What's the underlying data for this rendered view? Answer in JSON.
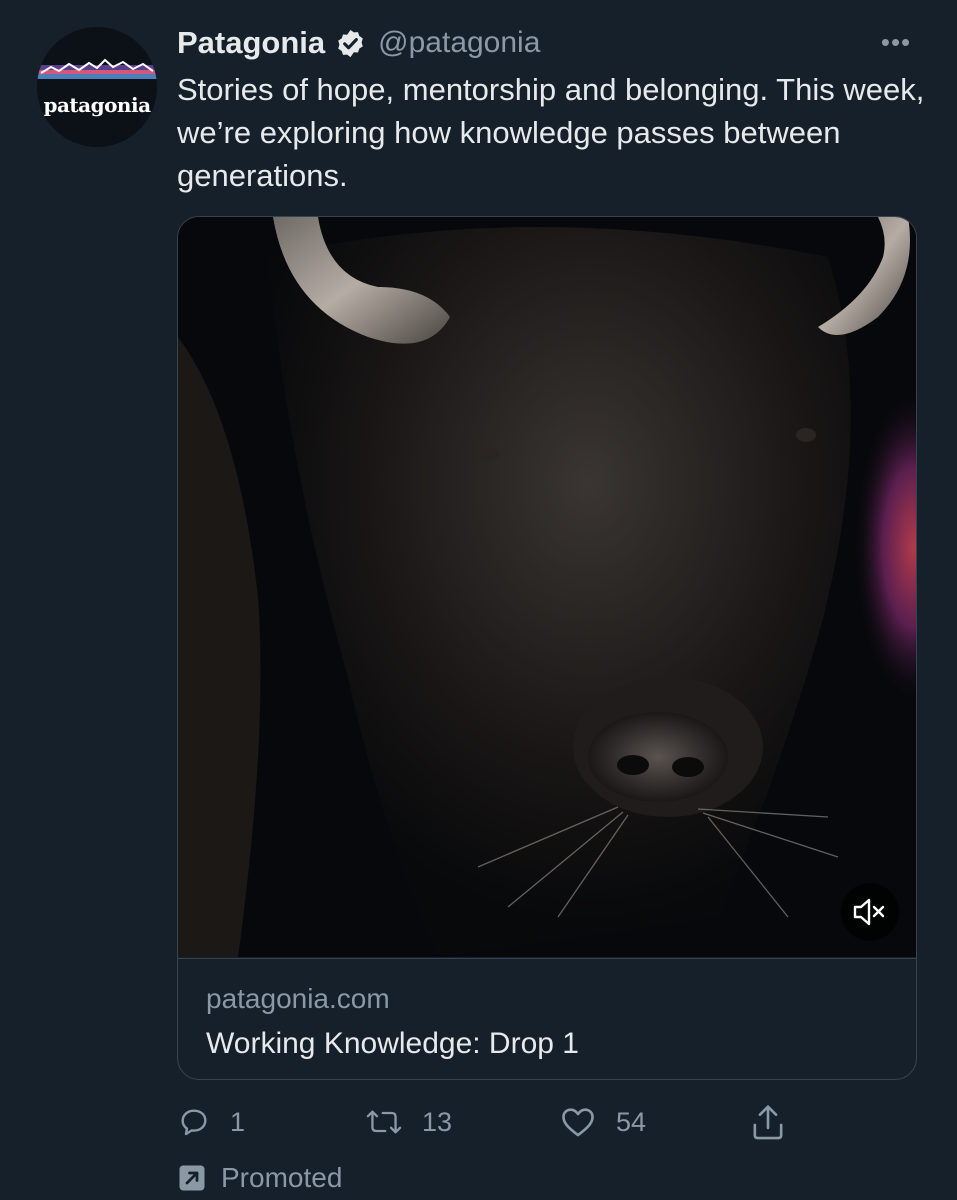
{
  "account": {
    "name": "Patagonia",
    "handle": "@patagonia",
    "avatar_text": "patagonia",
    "verified_icon": "verified-badge-icon"
  },
  "tweet": {
    "text": "Stories of hope, mentorship and belonging. This week, we’re exploring how knowledge passes between generations.",
    "more_icon": "more-options-icon"
  },
  "card": {
    "domain": "patagonia.com",
    "title": "Working Knowledge: Drop 1",
    "media_icon": "mute-icon"
  },
  "actions": {
    "reply_count": "1",
    "retweet_count": "13",
    "like_count": "54"
  },
  "promoted": {
    "label": "Promoted",
    "icon": "promoted-arrow-icon"
  },
  "colors": {
    "background": "#16202b",
    "text": "#e7e9ea",
    "secondary": "#8b98a5",
    "border": "#38444d"
  }
}
